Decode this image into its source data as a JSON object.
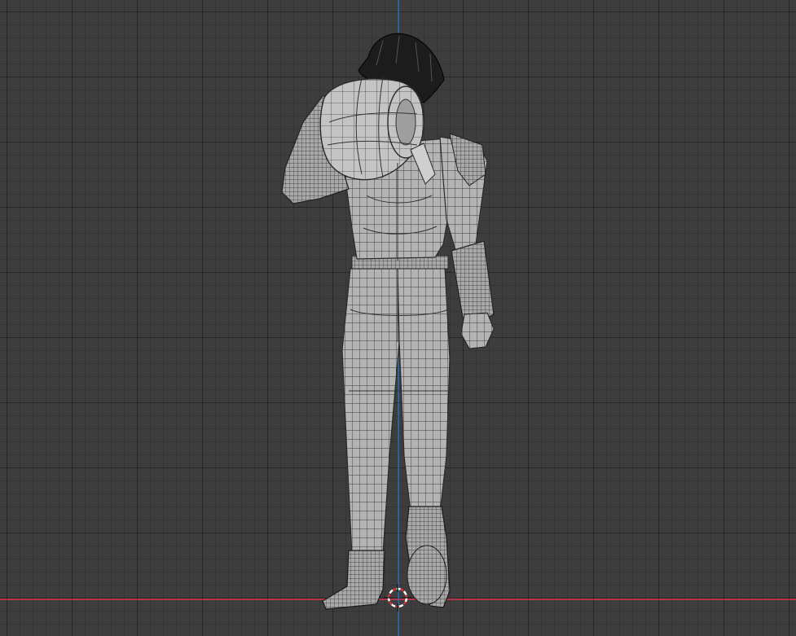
{
  "viewport": {
    "view": "back-orthographic",
    "background_color": "#3d3d3d",
    "grid": true,
    "axis_colors": {
      "x_axis": "#ff3352",
      "z_axis": "#2d7fd8"
    },
    "cursor_icon": "3d-cursor-icon"
  },
  "model": {
    "name": "character-mesh",
    "display": "wireframe-on-solid",
    "pose": "holding-hat-over-face"
  }
}
